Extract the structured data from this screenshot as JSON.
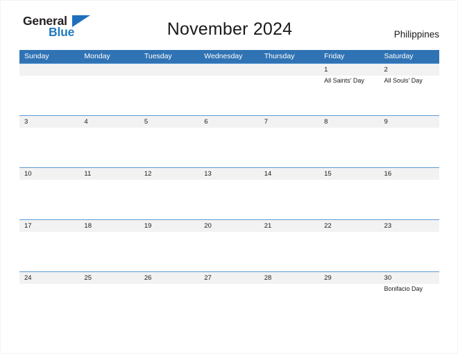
{
  "brand": {
    "name_part1": "General",
    "name_part2": "Blue",
    "triangle_icon": "triangle-icon"
  },
  "header": {
    "title": "November 2024",
    "region": "Philippines"
  },
  "colors": {
    "header_blue": "#3073b4",
    "row_divider_blue": "#5b9bd5",
    "band_gray": "#f2f2f2",
    "logo_blue": "#1f7ac0",
    "text_dark": "#1a1a1a"
  },
  "calendar": {
    "weekdays": [
      "Sunday",
      "Monday",
      "Tuesday",
      "Wednesday",
      "Thursday",
      "Friday",
      "Saturday"
    ],
    "weeks": [
      [
        {
          "day": "",
          "event": ""
        },
        {
          "day": "",
          "event": ""
        },
        {
          "day": "",
          "event": ""
        },
        {
          "day": "",
          "event": ""
        },
        {
          "day": "",
          "event": ""
        },
        {
          "day": "1",
          "event": "All Saints' Day"
        },
        {
          "day": "2",
          "event": "All Souls' Day"
        }
      ],
      [
        {
          "day": "3",
          "event": ""
        },
        {
          "day": "4",
          "event": ""
        },
        {
          "day": "5",
          "event": ""
        },
        {
          "day": "6",
          "event": ""
        },
        {
          "day": "7",
          "event": ""
        },
        {
          "day": "8",
          "event": ""
        },
        {
          "day": "9",
          "event": ""
        }
      ],
      [
        {
          "day": "10",
          "event": ""
        },
        {
          "day": "11",
          "event": ""
        },
        {
          "day": "12",
          "event": ""
        },
        {
          "day": "13",
          "event": ""
        },
        {
          "day": "14",
          "event": ""
        },
        {
          "day": "15",
          "event": ""
        },
        {
          "day": "16",
          "event": ""
        }
      ],
      [
        {
          "day": "17",
          "event": ""
        },
        {
          "day": "18",
          "event": ""
        },
        {
          "day": "19",
          "event": ""
        },
        {
          "day": "20",
          "event": ""
        },
        {
          "day": "21",
          "event": ""
        },
        {
          "day": "22",
          "event": ""
        },
        {
          "day": "23",
          "event": ""
        }
      ],
      [
        {
          "day": "24",
          "event": ""
        },
        {
          "day": "25",
          "event": ""
        },
        {
          "day": "26",
          "event": ""
        },
        {
          "day": "27",
          "event": ""
        },
        {
          "day": "28",
          "event": ""
        },
        {
          "day": "29",
          "event": ""
        },
        {
          "day": "30",
          "event": "Bonifacio Day"
        }
      ]
    ]
  }
}
